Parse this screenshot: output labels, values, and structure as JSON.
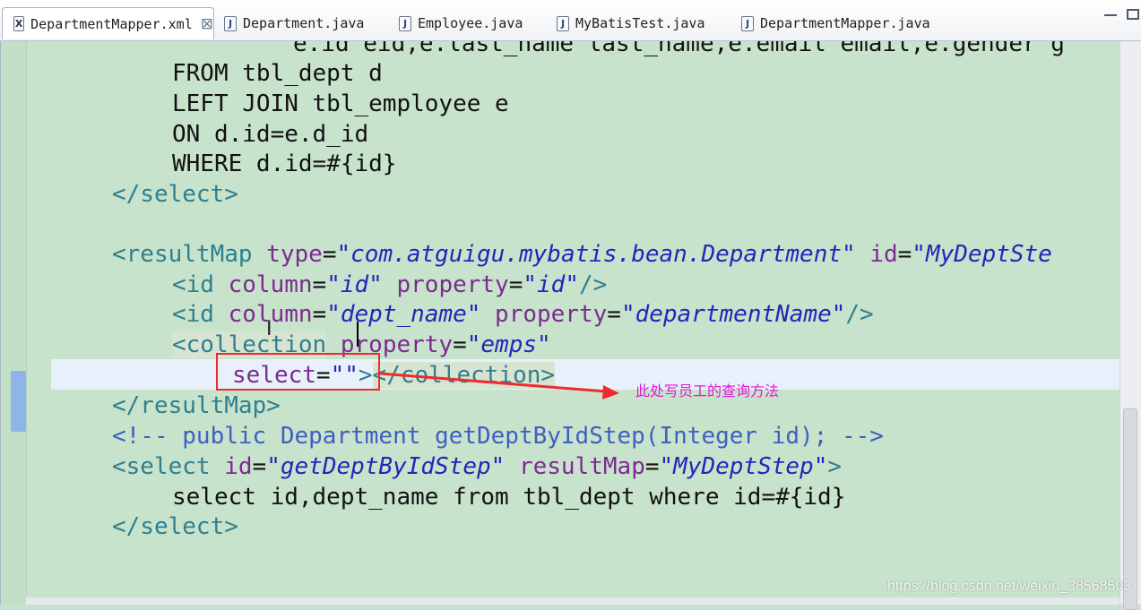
{
  "tabs": [
    {
      "label": "DepartmentMapper.xml",
      "icon": "xml-file-icon",
      "icon_glyph": "X",
      "active": true,
      "closable": true
    },
    {
      "label": "Department.java",
      "icon": "java-file-icon",
      "icon_glyph": "J",
      "active": false
    },
    {
      "label": "Employee.java",
      "icon": "java-file-icon",
      "icon_glyph": "J",
      "active": false
    },
    {
      "label": "MyBatisTest.java",
      "icon": "java-file-icon",
      "icon_glyph": "J",
      "active": false
    },
    {
      "label": "DepartmentMapper.java",
      "icon": "java-file-icon",
      "icon_glyph": "J",
      "active": false
    }
  ],
  "close_glyph": "⊠",
  "editor": {
    "lines": {
      "l0": "e.id eid,e.last_name last_name,e.email email,e.gender g",
      "l1": "FROM tbl_dept d",
      "l2": "LEFT JOIN tbl_employee e",
      "l3": "ON d.id=e.d_id",
      "l4": "WHERE d.id=#{id}",
      "l5": "</select>",
      "rm_open": "<resultMap",
      "rm_type_attr": "type",
      "rm_type_val": "\"com.atguigu.mybatis.bean.Department\"",
      "rm_id_attr": "id",
      "rm_id_val": "\"MyDeptSte",
      "id1_tag": "<id",
      "id1_col_attr": "column",
      "id1_col_val": "\"id\"",
      "id1_prop_attr": "property",
      "id1_prop_val": "\"id\"",
      "id1_close": "/>",
      "id2_tag": "<id",
      "id2_col_attr": "column",
      "id2_col_val": "\"dept_name\"",
      "id2_prop_attr": "property",
      "id2_prop_val": "\"departmentName\"",
      "id2_close": "/>",
      "coll_lt": "<",
      "coll_tag": "collection",
      "coll_prop_attr": "property",
      "coll_prop_val": "\"emps\"",
      "sel_attr": "select",
      "sel_val": "\"\"",
      "sel_gt": ">",
      "coll_end": "</collection>",
      "rm_end": "</resultMap>",
      "comment": "<!-- public Department getDeptByIdStep(Integer id); -->",
      "s_open": "<select",
      "s_id_attr": "id",
      "s_id_val": "\"getDeptByIdStep\"",
      "s_rm_attr": "resultMap",
      "s_rm_val": "\"MyDeptStep\"",
      "s_gt": ">",
      "s_body": "select id,dept_name from tbl_dept where id=#{id}",
      "s_end": "</select>"
    }
  },
  "annotation": {
    "note": "此处写员工的查询方法",
    "color": "#e019d6",
    "box_color": "#ee2b2b"
  },
  "watermark": "https://blog.csdn.net/weixin_38568503",
  "colors": {
    "background": "#c7e3cc",
    "tag": "#2f7f8f",
    "attribute": "#7d2a90",
    "value": "#2525b8",
    "comment": "#3f5fbf"
  }
}
